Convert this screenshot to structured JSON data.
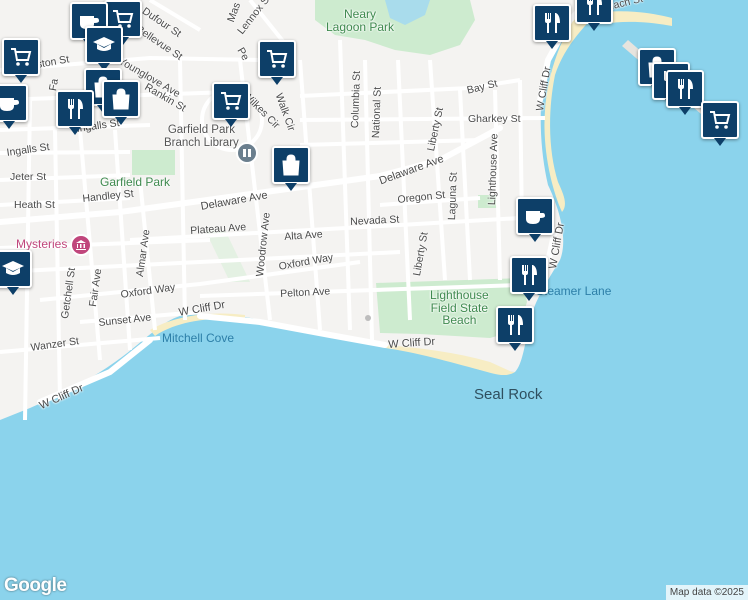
{
  "colors": {
    "water": "#8bd3ec",
    "land": "#f4f3f1",
    "park": "#cdebcf",
    "beach": "#f7edc4",
    "road": "#ffffff",
    "pin": "#0d3f68"
  },
  "streets": {
    "columbia": "Columbia St",
    "national": "National St",
    "liberty_n": "Liberty St",
    "laguna": "Laguna St",
    "lighthouse": "Lighthouse Ave",
    "bay": "Bay St",
    "gharkey": "Gharkey St",
    "wcliff_ne": "W Cliff Dr",
    "beach_st": "Beach St",
    "lennox": "Lennox St",
    "dufour": "Dufour St",
    "bellevue": "Bellevue St",
    "younglove": "Younglove Ave",
    "rankin": "Rankin St",
    "ingalls_a": "Ingalls St",
    "ingalls_b": "Ingalls St",
    "jeter": "Jeter St",
    "heath": "Heath St",
    "handley": "Handley St",
    "delaware": "Delaware Ave",
    "delaware2": "Delaware Ave",
    "oregon": "Oregon St",
    "nevada": "Nevada St",
    "plateau": "Plateau Ave",
    "alta": "Alta Ave",
    "woodrow": "Woodrow Ave",
    "almar": "Almar Ave",
    "fair": "Fair Ave",
    "getchell": "Getchell St",
    "oxford_way": "Oxford Way",
    "oxford_way2": "Oxford Way",
    "liberty_s": "Liberty St",
    "pelton": "Pelton Ave",
    "sunset": "Sunset Ave",
    "wcliff_mid": "W Cliff Dr",
    "wanzer": "Wanzer St",
    "wcliff_sw": "W Cliff Dr",
    "wcliff_s": "W Cliff Dr",
    "wcliff_e": "W Cliff Dr",
    "wilkes": "Wilkes Cir",
    "walk": "Walk Cir",
    "fa": "Fa",
    "ston": "ston St",
    "mas": "Mas",
    "per": "Pe"
  },
  "places": {
    "neary": "Neary\nLagoon Park",
    "garfield_library": "Garfield Park\nBranch Library",
    "garfield_park": "Garfield Park",
    "mysteries": "Mysteries",
    "lighthouse_beach": "Lighthouse\nField State\nBeach",
    "steamer": "Steamer Lane",
    "mitchell": "Mitchell Cove",
    "seal_rock": "Seal Rock"
  },
  "icons": {
    "shopping_cart": "shopping-cart-icon",
    "restaurant": "restaurant-icon",
    "shopping_bag": "shopping-bag-icon",
    "cafe": "coffee-cup-icon",
    "school": "school-icon",
    "library": "library-icon",
    "museum": "museum-icon"
  },
  "footer": {
    "logo": "Google",
    "attribution": "Map data ©2025"
  }
}
